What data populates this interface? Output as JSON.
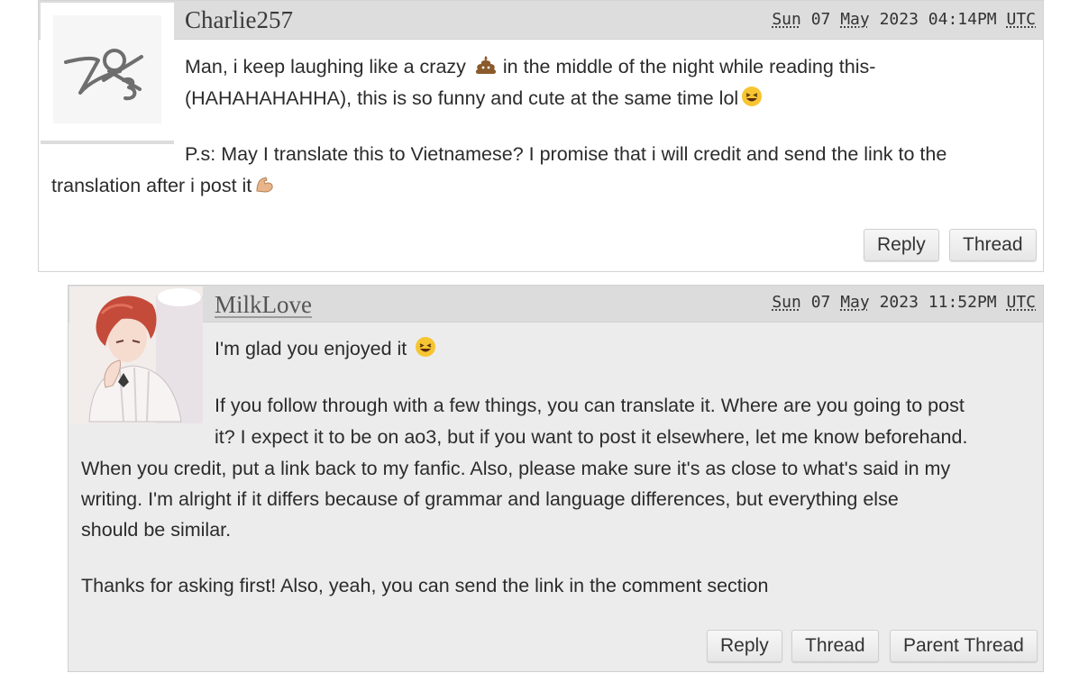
{
  "comments": [
    {
      "username": "Charlie257",
      "date": {
        "day": "Sun",
        "date": "07",
        "month": "May",
        "year": "2023",
        "time": "04:14PM",
        "tz": "UTC"
      },
      "lines": [
        "Man, i keep laughing like a crazy",
        "in the middle of the night while reading this-",
        "(HAHAHAHAHHA), this is so funny and cute at the same time lol",
        "P.s: May I translate this to Vietnamese? I promise that i will credit and send the link to the",
        "translation after i post it"
      ],
      "buttons": {
        "reply": "Reply",
        "thread": "Thread"
      }
    },
    {
      "username": "MilkLove",
      "date": {
        "day": "Sun",
        "date": "07",
        "month": "May",
        "year": "2023",
        "time": "11:52PM",
        "tz": "UTC"
      },
      "lines": [
        "I'm glad you enjoyed it",
        "If you follow through with a few things, you can translate it. Where are you going to post",
        "it? I expect it to be on ao3, but if you want to post it elsewhere, let me know beforehand.",
        "When you credit, put a link back to my fanfic. Also, please make sure it's as close to what's said in my",
        "writing. I'm alright if it differs because of grammar and language differences, but everything else",
        "should be similar.",
        "Thanks for asking first! Also, yeah, you can send the link in the comment section"
      ],
      "buttons": {
        "reply": "Reply",
        "thread": "Thread",
        "parent": "Parent Thread"
      }
    }
  ],
  "icons": {
    "poop": "pile-of-poo-emoji",
    "laugh": "grinning-squinting-emoji",
    "muscle": "flexed-biceps-emoji",
    "default_avatar": "ao3-default-avatar",
    "user_avatar": "anime-redhead-avatar"
  }
}
